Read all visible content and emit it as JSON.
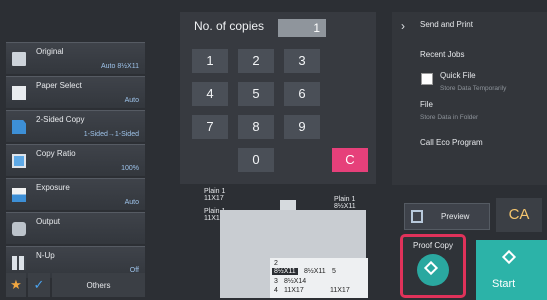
{
  "settings": [
    {
      "name": "Original",
      "value": "Auto 8½X11",
      "icon": "document-icon"
    },
    {
      "name": "Paper Select",
      "value": "Auto",
      "icon": "paper-icon"
    },
    {
      "name": "2-Sided Copy",
      "value": "1-Sided→1-Sided",
      "icon": "duplex-icon"
    },
    {
      "name": "Copy Ratio",
      "value": "100%",
      "icon": "ratio-icon"
    },
    {
      "name": "Exposure",
      "value": "Auto",
      "icon": "exposure-icon"
    },
    {
      "name": "Output",
      "value": "",
      "icon": "output-icon"
    },
    {
      "name": "N-Up",
      "value": "Off",
      "icon": "n-up-icon"
    }
  ],
  "bottom_bar": {
    "others_label": "Others",
    "star_icon": "★",
    "check_icon": "✓"
  },
  "copies": {
    "label": "No. of copies",
    "value": "1"
  },
  "keypad": {
    "keys": [
      "1",
      "2",
      "3",
      "4",
      "5",
      "6",
      "7",
      "8",
      "9",
      "0"
    ],
    "clear": "C"
  },
  "menu": {
    "tab_icon": "›",
    "send_and_print": "Send and Print",
    "recent_jobs": "Recent Jobs",
    "quick_file": "Quick File",
    "quick_file_sub": "Store Data Temporarily",
    "file": "File",
    "file_sub": "Store Data in Folder",
    "call_eco": "Call Eco Program"
  },
  "preview": {
    "label": "Preview"
  },
  "ca": {
    "label": "CA"
  },
  "proof_copy": {
    "label": "Proof Copy"
  },
  "start": {
    "label": "Start"
  },
  "diagram": {
    "tray_a": "Plain 1\n11X17",
    "tray_b": "Plain 1\n11X17",
    "tray_c": "Plain 1\n8½X11",
    "table": [
      {
        "no": "1",
        "size": "8½X11"
      },
      {
        "no": "2",
        "size": "8½X11"
      },
      {
        "no": "3",
        "size": "8½X14"
      },
      {
        "no": "4",
        "size": "11X17"
      },
      {
        "no": "5",
        "size": ""
      },
      {
        "no": "",
        "size": "11X17"
      }
    ]
  },
  "colors": {
    "clear_key": "#e6407a",
    "start": "#2cb3a8",
    "proof_highlight": "#e0325a",
    "ca": "#f4c56e"
  }
}
